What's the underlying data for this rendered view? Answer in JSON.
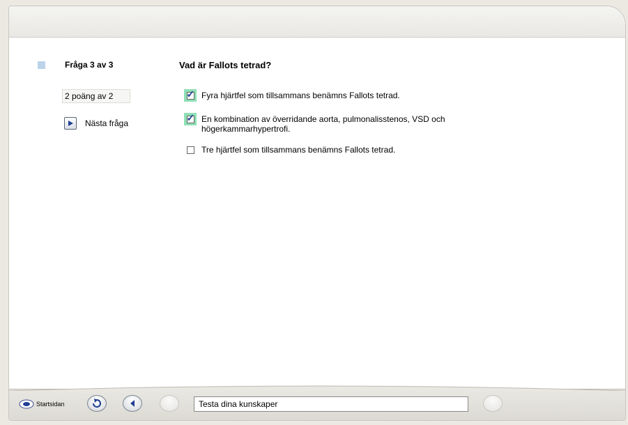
{
  "quiz": {
    "question_counter": "Fråga 3 av 3",
    "question_title": "Vad är Fallots tetrad?",
    "score": "2 poäng av 2",
    "next_label": "Nästa fråga",
    "answers": [
      {
        "text": "Fyra hjärtfel som tillsammans benämns Fallots tetrad.",
        "checked": true,
        "correct": true
      },
      {
        "text": "En kombination av överridande aorta, pulmonalisstenos, VSD och högerkammarhypertrofi.",
        "checked": true,
        "correct": true
      },
      {
        "text": "Tre hjärtfel som tillsammans benämns Fallots tetrad.",
        "checked": false,
        "correct": false
      }
    ]
  },
  "footer": {
    "home_label": "Startsidan",
    "status_text": "Testa dina kunskaper"
  },
  "colors": {
    "correct_highlight": "#8fe0b6",
    "check_mark": "#1f3f92",
    "question_marker": "#bcd3ea"
  },
  "icons": {
    "next": "play-icon",
    "refresh": "refresh-icon",
    "back": "back-arrow-icon"
  }
}
